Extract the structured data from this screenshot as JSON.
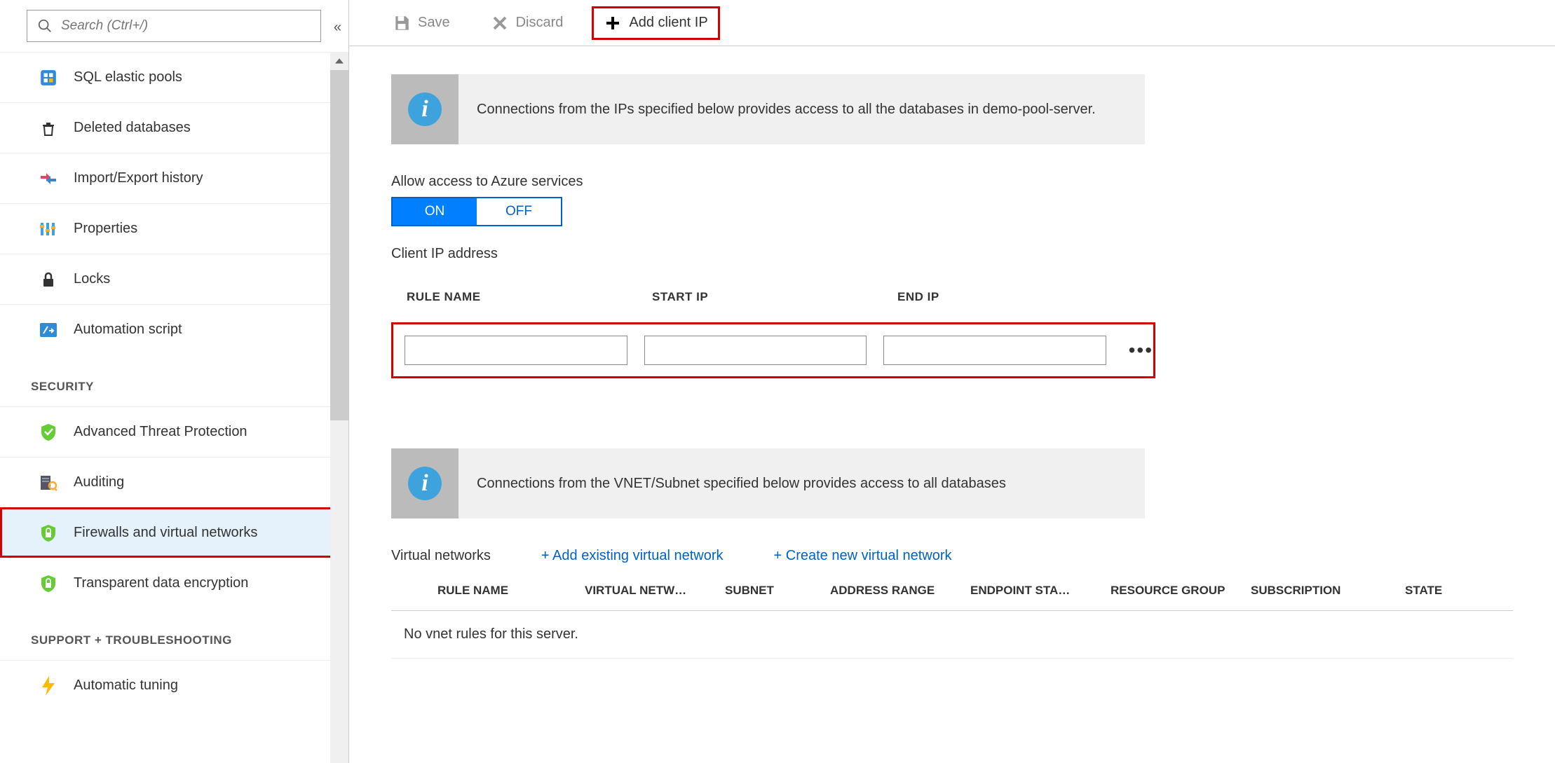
{
  "search": {
    "placeholder": "Search (Ctrl+/)"
  },
  "sidebar": {
    "items": [
      {
        "label": "SQL elastic pools",
        "icon": "sql-pool"
      },
      {
        "label": "Deleted databases",
        "icon": "trash"
      },
      {
        "label": "Import/Export history",
        "icon": "import-export"
      },
      {
        "label": "Properties",
        "icon": "properties"
      },
      {
        "label": "Locks",
        "icon": "lock"
      },
      {
        "label": "Automation script",
        "icon": "automation"
      }
    ],
    "security_header": "SECURITY",
    "security_items": [
      {
        "label": "Advanced Threat Protection",
        "icon": "shield-check"
      },
      {
        "label": "Auditing",
        "icon": "auditing"
      },
      {
        "label": "Firewalls and virtual networks",
        "icon": "shield-lock",
        "selected": true,
        "highlighted": true
      },
      {
        "label": "Transparent data encryption",
        "icon": "shield-lock-green"
      }
    ],
    "support_header": "SUPPORT + TROUBLESHOOTING",
    "support_items": [
      {
        "label": "Automatic tuning",
        "icon": "bolt"
      }
    ]
  },
  "toolbar": {
    "save": "Save",
    "discard": "Discard",
    "add_client_ip": "Add client IP"
  },
  "banner1": "Connections from the IPs specified below provides access to all the databases in demo-pool-server.",
  "allow_label": "Allow access to Azure services",
  "toggle": {
    "on": "ON",
    "off": "OFF"
  },
  "client_ip_label": "Client IP address",
  "fw_headers": {
    "name": "RULE NAME",
    "start": "START IP",
    "end": "END IP"
  },
  "banner2": "Connections from the VNET/Subnet specified below provides access to all databases",
  "vnet": {
    "title": "Virtual networks",
    "add_existing": "+ Add existing virtual network",
    "create_new": "+ Create new virtual network",
    "headers": {
      "rule": "RULE NAME",
      "vnet": "VIRTUAL NETW…",
      "subnet": "SUBNET",
      "range": "ADDRESS RANGE",
      "endpoint": "ENDPOINT STA…",
      "rg": "RESOURCE GROUP",
      "sub": "SUBSCRIPTION",
      "state": "STATE"
    },
    "empty": "No vnet rules for this server."
  }
}
